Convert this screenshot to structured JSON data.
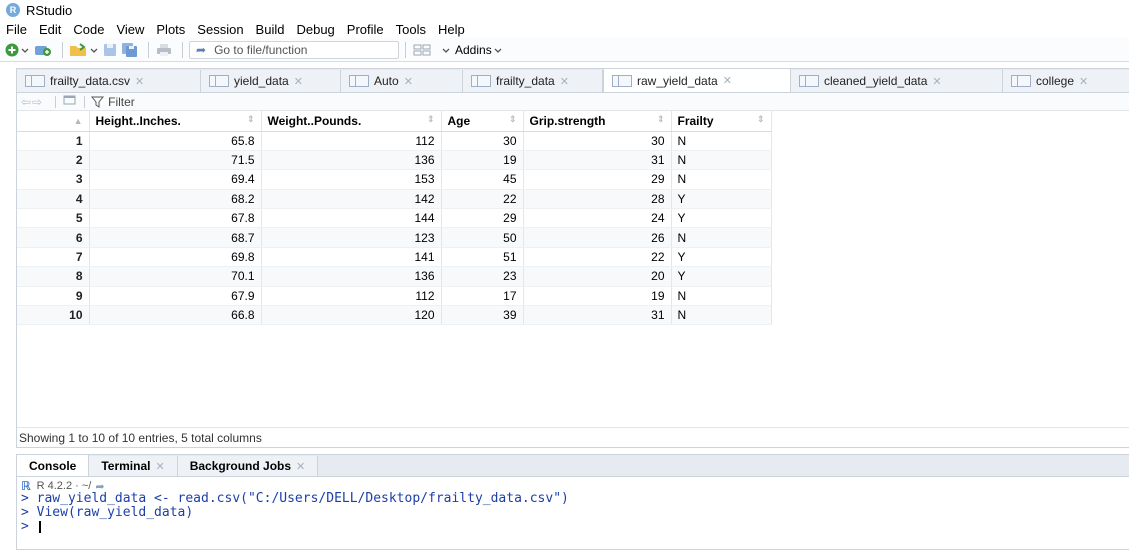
{
  "window": {
    "title": "RStudio",
    "logo": "R"
  },
  "menu": [
    "File",
    "Edit",
    "Code",
    "View",
    "Plots",
    "Session",
    "Build",
    "Debug",
    "Profile",
    "Tools",
    "Help"
  ],
  "toolbar": {
    "goto_placeholder": "Go to file/function",
    "addins_label": "Addins"
  },
  "editor_tabs": [
    {
      "label": "frailty_data.csv",
      "active": false
    },
    {
      "label": "yield_data",
      "active": false
    },
    {
      "label": "Auto",
      "active": false
    },
    {
      "label": "frailty_data",
      "active": false
    },
    {
      "label": "raw_yield_data",
      "active": true
    },
    {
      "label": "cleaned_yield_data",
      "active": false
    },
    {
      "label": "college",
      "active": false
    }
  ],
  "filterbar": {
    "filter_label": "Filter"
  },
  "table": {
    "columns": [
      "Height..Inches.",
      "Weight..Pounds.",
      "Age",
      "Grip.strength",
      "Frailty"
    ],
    "rows": [
      [
        "1",
        "65.8",
        "112",
        "30",
        "30",
        "N"
      ],
      [
        "2",
        "71.5",
        "136",
        "19",
        "31",
        "N"
      ],
      [
        "3",
        "69.4",
        "153",
        "45",
        "29",
        "N"
      ],
      [
        "4",
        "68.2",
        "142",
        "22",
        "28",
        "Y"
      ],
      [
        "5",
        "67.8",
        "144",
        "29",
        "24",
        "Y"
      ],
      [
        "6",
        "68.7",
        "123",
        "50",
        "26",
        "N"
      ],
      [
        "7",
        "69.8",
        "141",
        "51",
        "22",
        "Y"
      ],
      [
        "8",
        "70.1",
        "136",
        "23",
        "20",
        "Y"
      ],
      [
        "9",
        "67.9",
        "112",
        "17",
        "19",
        "N"
      ],
      [
        "10",
        "66.8",
        "120",
        "39",
        "31",
        "N"
      ]
    ]
  },
  "status_text": "Showing 1 to 10 of 10 entries, 5 total columns",
  "console": {
    "tabs": [
      "Console",
      "Terminal",
      "Background Jobs"
    ],
    "r_version": "R 4.2.2 · ~/",
    "lines": [
      "> raw_yield_data <- read.csv(\"C:/Users/DELL/Desktop/frailty_data.csv\")",
      "> View(raw_yield_data)",
      "> "
    ]
  }
}
